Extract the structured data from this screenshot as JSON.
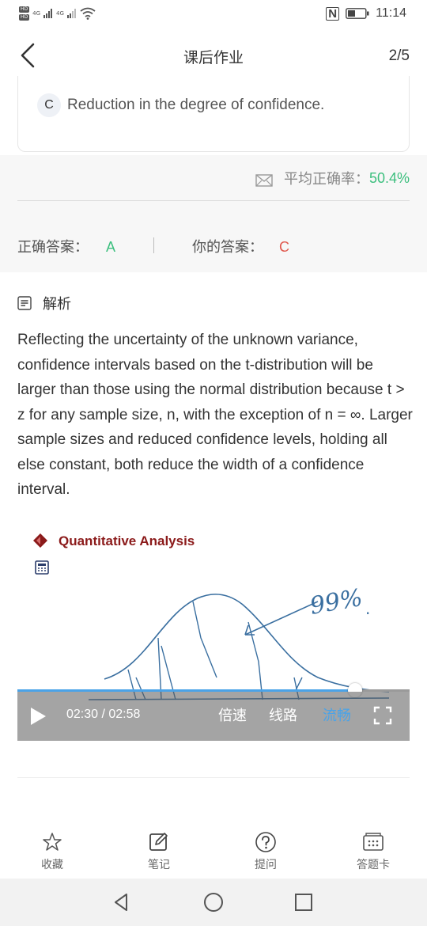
{
  "status_bar": {
    "hd1": "HD",
    "hd2": "HD",
    "signal1": "4G",
    "signal2": "4G",
    "nfc": "N",
    "time": "11:14"
  },
  "header": {
    "title": "课后作业",
    "counter": "2/5"
  },
  "option": {
    "letter": "C",
    "text": "Reduction in the degree of confidence."
  },
  "accuracy": {
    "label": "平均正确率：",
    "value": "50.4%"
  },
  "answers": {
    "correct_label": "正确答案：",
    "correct_value": "A",
    "separator": "|",
    "yours_label": "你的答案：",
    "yours_value": "C"
  },
  "analysis": {
    "title": "解析",
    "text": "Reflecting the uncertainty of the unknown variance, confidence intervals based on the t-distribution will be larger than those using the normal distribution because t > z for any sample size, n, with the exception of n = ∞. Larger sample sizes and reduced confidence levels, holding all else constant, both reduce the width of a confidence interval."
  },
  "video": {
    "slide_title": "Quantitative Analysis",
    "annotation": "99%",
    "time": "02:30 / 02:58",
    "progress": 0.86,
    "speed_label": "倍速",
    "route_label": "线路",
    "quality_label": "流畅",
    "accent": "#4aa3e8"
  },
  "toolbar": {
    "favorite": "收藏",
    "note": "笔记",
    "ask": "提问",
    "card": "答题卡"
  },
  "colors": {
    "green": "#3cbf7e",
    "red": "#e0594e",
    "brand_red": "#8b1a1a"
  }
}
